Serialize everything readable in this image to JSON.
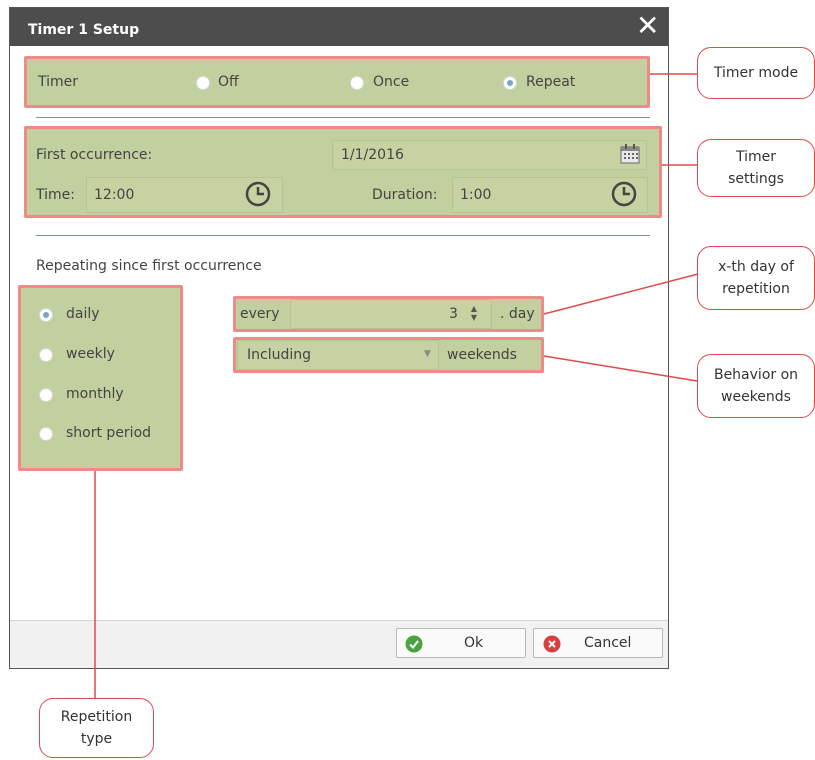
{
  "dialog": {
    "title": "Timer 1 Setup",
    "close_icon": "close-icon"
  },
  "timer_mode": {
    "label": "Timer",
    "options": [
      "Off",
      "Once",
      "Repeat"
    ],
    "selected": "Repeat"
  },
  "timer_settings": {
    "first_occurrence_label": "First occurrence:",
    "first_occurrence_value": "1/1/2016",
    "time_label": "Time:",
    "time_value": "12:00",
    "duration_label": "Duration:",
    "duration_value": "1:00"
  },
  "repeating": {
    "heading": "Repeating since first occurrence",
    "types": [
      "daily",
      "weekly",
      "monthly",
      "short period"
    ],
    "selected_type": "daily",
    "every_label": "every",
    "every_value": "3",
    "day_suffix": ". day",
    "weekend_select_value": "Including",
    "weekends_label": "weekends"
  },
  "buttons": {
    "ok": "Ok",
    "cancel": "Cancel"
  },
  "annotations": {
    "timer_mode": "Timer mode",
    "timer_settings_l1": "Timer",
    "timer_settings_l2": "settings",
    "xth_day_l1": "x-th day of",
    "xth_day_l2": "repetition",
    "weekends_l1": "Behavior on",
    "weekends_l2": "weekends",
    "repetition_l1": "Repetition",
    "repetition_l2": "type"
  },
  "colors": {
    "highlight_fill": "#c2cf9e",
    "highlight_border": "#f08a8a",
    "titlebar": "#4d4d4d",
    "callout_line": "#e04a4a"
  }
}
